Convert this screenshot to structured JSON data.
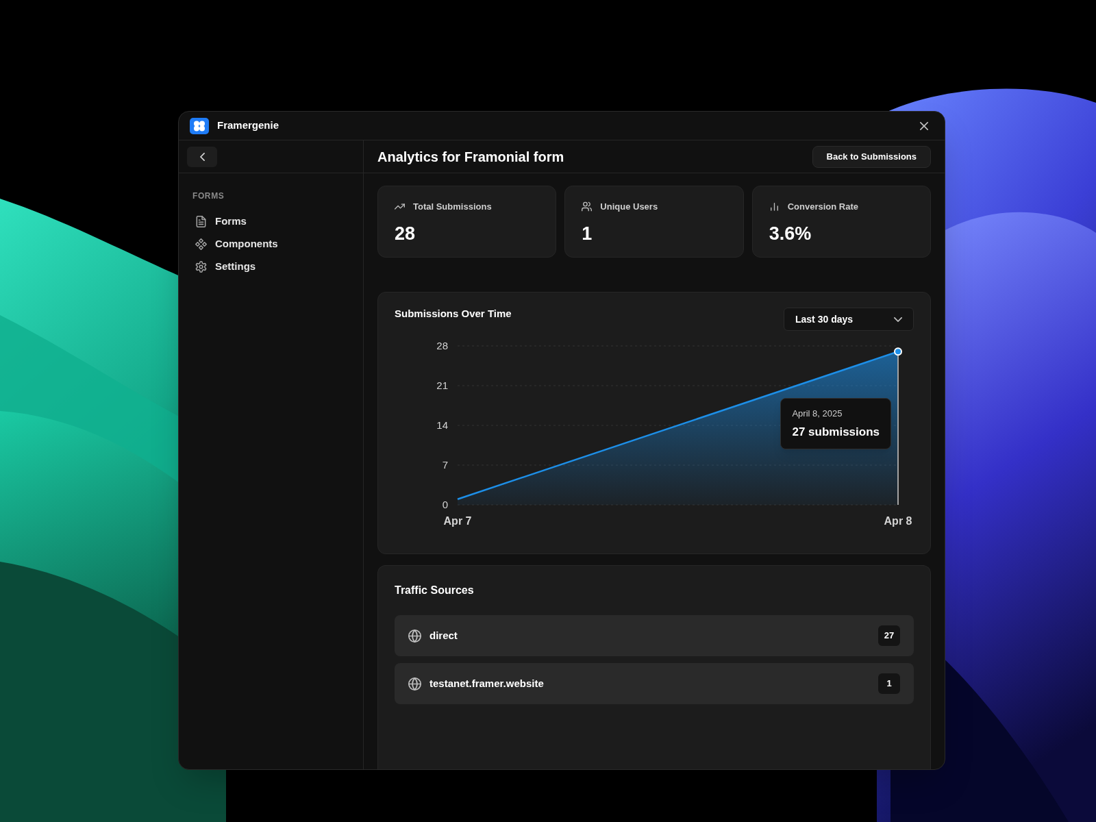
{
  "window": {
    "title": "Framergenie"
  },
  "sidebar": {
    "section_label": "FORMS",
    "items": [
      {
        "label": "Forms",
        "selected": false
      },
      {
        "label": "Components",
        "selected": false
      },
      {
        "label": "Settings",
        "selected": false
      }
    ]
  },
  "header": {
    "title": "Analytics for Framonial form",
    "back_button": "Back to Submissions"
  },
  "stats": [
    {
      "label": "Total Submissions",
      "value": "28"
    },
    {
      "label": "Unique Users",
      "value": "1"
    },
    {
      "label": "Conversion Rate",
      "value": "3.6%"
    }
  ],
  "submissions_chart": {
    "title": "Submissions Over Time",
    "range_select": {
      "value": "Last 30 days"
    },
    "chart_data": {
      "type": "area",
      "categories": [
        "Apr 7",
        "Apr 8"
      ],
      "values": [
        1,
        27
      ],
      "ylim": [
        0,
        28
      ],
      "yticks": [
        0,
        7,
        14,
        21,
        28
      ],
      "ref_lines": [
        {
          "axis": "y",
          "value": 0
        },
        {
          "axis": "y",
          "value": 7
        },
        {
          "axis": "y",
          "value": 14
        },
        {
          "axis": "y",
          "value": 21
        },
        {
          "axis": "y",
          "value": 28
        }
      ]
    },
    "tooltip": {
      "date": "April 8, 2025",
      "value": "27 submissions"
    }
  },
  "traffic_sources": {
    "title": "Traffic Sources",
    "items": [
      {
        "label": "direct",
        "count": "27"
      },
      {
        "label": "testanet.framer.website",
        "count": "1"
      }
    ]
  }
}
